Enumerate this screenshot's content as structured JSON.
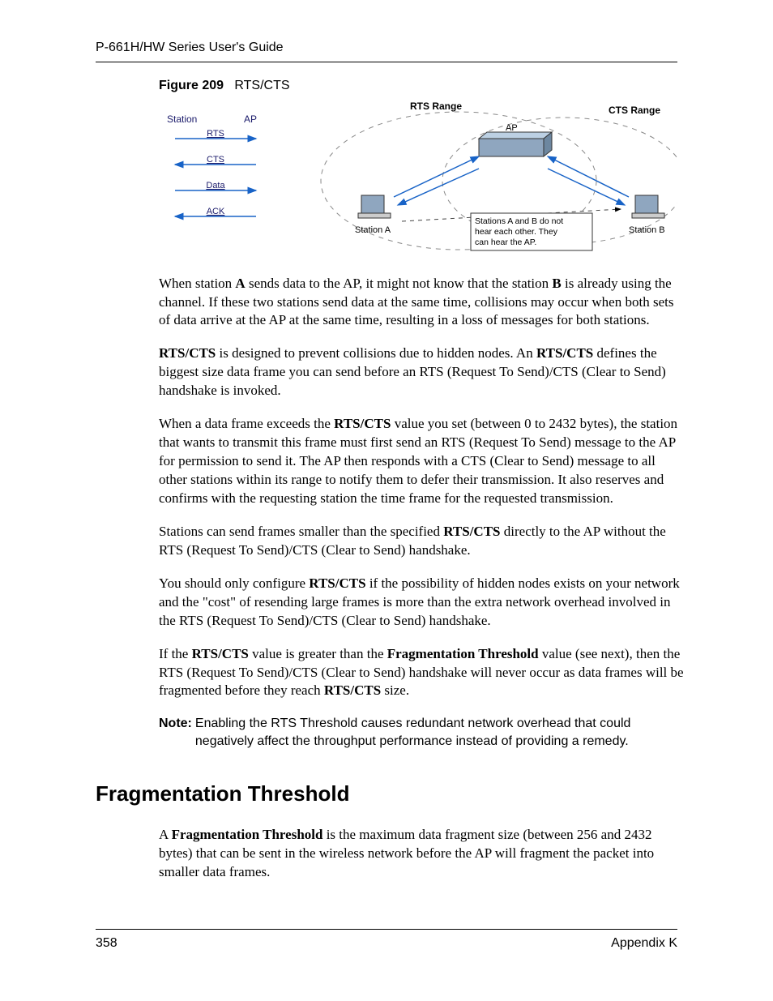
{
  "header": {
    "title": "P-661H/HW Series User's Guide"
  },
  "figure": {
    "number": "Figure 209",
    "title": "RTS/CTS",
    "labels": {
      "station": "Station",
      "ap": "AP",
      "rts": "RTS",
      "cts": "CTS",
      "data": "Data",
      "ack": "ACK",
      "rts_range": "RTS Range",
      "cts_range": "CTS Range",
      "station_a": "Station  A",
      "station_b": "Station B",
      "note_l1": "Stations A and B do not",
      "note_l2": "hear each other. They",
      "note_l3": "can hear the AP."
    }
  },
  "paragraphs": {
    "p1_a": "When station ",
    "p1_b": "A",
    "p1_c": " sends data to the AP, it might not know that the station ",
    "p1_d": "B",
    "p1_e": " is already using the channel. If these two stations send data at the same time, collisions may occur when both sets of data arrive at the AP at the same time, resulting in a loss of messages for both stations.",
    "p2_a": "RTS/CTS",
    "p2_b": " is designed to prevent collisions due to hidden nodes. An ",
    "p2_c": "RTS/CTS",
    "p2_d": " defines the biggest size data frame you can send before an RTS (Request To Send)/CTS (Clear to Send) handshake is invoked.",
    "p3_a": "When a data frame exceeds the ",
    "p3_b": "RTS/CTS",
    "p3_c": " value you set (between 0 to 2432 bytes), the station that wants to transmit this frame must first send an RTS (Request To Send) message to the AP for permission to send it. The AP then responds with a CTS (Clear to Send) message to all other stations within its range to notify them to defer their transmission. It also reserves and confirms with the requesting station the time frame for the requested transmission.",
    "p4_a": "Stations can send frames smaller than the specified ",
    "p4_b": "RTS/CTS",
    "p4_c": " directly to the AP without the RTS (Request To Send)/CTS (Clear to Send) handshake.",
    "p5_a": "You should only configure ",
    "p5_b": "RTS/CTS",
    "p5_c": " if the possibility of hidden nodes exists on your network and the \"cost\" of resending large frames is more than the extra network overhead involved in the RTS (Request To Send)/CTS (Clear to Send) handshake.",
    "p6_a": "If the ",
    "p6_b": "RTS/CTS",
    "p6_c": " value is greater than the ",
    "p6_d": "Fragmentation Threshold",
    "p6_e": " value (see next), then the RTS (Request To Send)/CTS (Clear to Send) handshake will never occur as data frames will be fragmented before they reach ",
    "p6_f": "RTS/CTS",
    "p6_g": " size.",
    "note_label": "Note:",
    "note_text": "Enabling the RTS Threshold causes redundant network overhead that could negatively affect the throughput performance instead of providing a remedy."
  },
  "section2": {
    "heading": "Fragmentation Threshold",
    "p_a": "A ",
    "p_b": "Fragmentation Threshold",
    "p_c": " is the maximum data fragment size (between 256 and 2432 bytes) that can be sent in the wireless network before the AP will fragment the packet into smaller data frames."
  },
  "footer": {
    "page": "358",
    "section": "Appendix K"
  }
}
